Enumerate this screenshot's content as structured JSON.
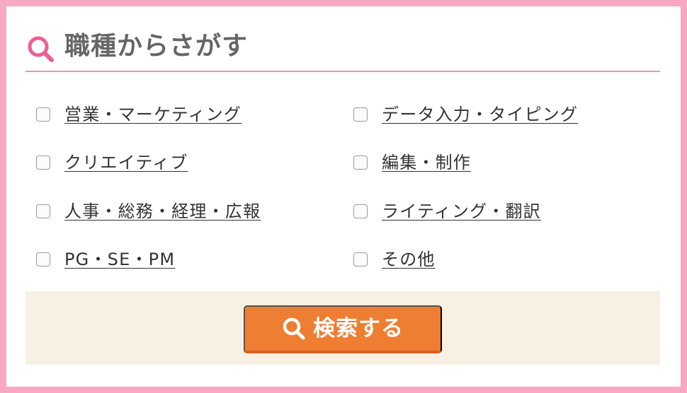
{
  "section": {
    "title": "職種からさがす",
    "icon": "search-icon",
    "accent_color": "#f093b4",
    "frame_color": "#f7a8c3"
  },
  "options": [
    {
      "label": "営業・マーケティング",
      "checked": false
    },
    {
      "label": "データ入力・タイピング",
      "checked": false
    },
    {
      "label": "クリエイティブ",
      "checked": false
    },
    {
      "label": "編集・制作",
      "checked": false
    },
    {
      "label": "人事・総務・経理・広報",
      "checked": false
    },
    {
      "label": "ライティング・翻訳",
      "checked": false
    },
    {
      "label": "PG・SE・PM",
      "checked": false
    },
    {
      "label": "その他",
      "checked": false
    }
  ],
  "submit": {
    "label": "検索する",
    "icon": "search-icon",
    "color": "#ee7e32",
    "area_color": "#f8f0e3"
  }
}
